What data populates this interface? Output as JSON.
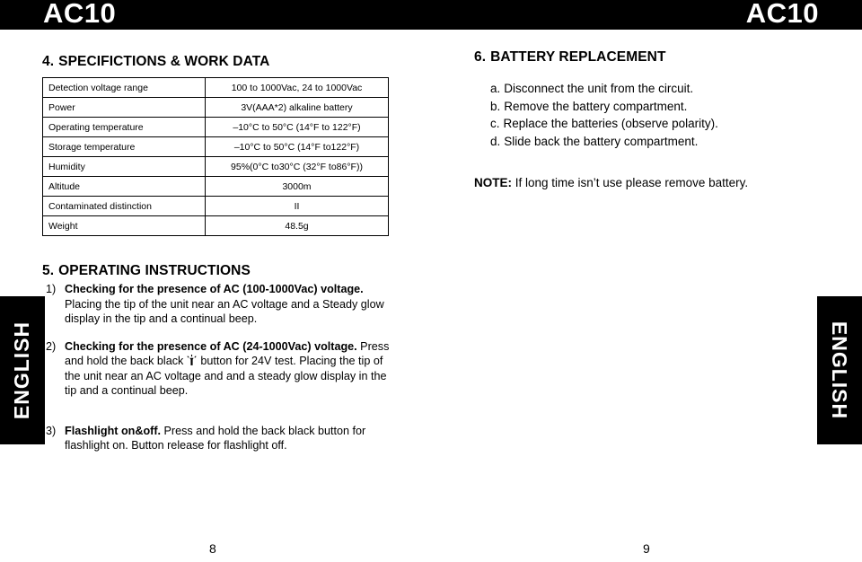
{
  "header": {
    "title_left": "AC10",
    "title_right": "AC10"
  },
  "side_tabs": {
    "left_label": "ENGLISH",
    "right_label": "ENGLISH"
  },
  "specifications": {
    "heading_number": "4.",
    "heading_text": "SPECIFICTIONS & WORK DATA",
    "rows": [
      {
        "label": "Detection voltage range",
        "value": "100 to 1000Vac, 24 to 1000Vac"
      },
      {
        "label": "Power",
        "value": "3V(AAA*2) alkaline battery"
      },
      {
        "label": "Operating temperature",
        "value": "–10°C to 50°C (14°F to 122°F)"
      },
      {
        "label": "Storage temperature",
        "value": "–10°C to 50°C (14°F to122°F)"
      },
      {
        "label": "Humidity",
        "value": "95%(0°C to30°C (32°F to86°F))"
      },
      {
        "label": "Altitude",
        "value": "3000m"
      },
      {
        "label": "Contaminated distinction",
        "value": "II"
      },
      {
        "label": "Weight",
        "value": "48.5g"
      }
    ]
  },
  "operating_instructions": {
    "heading_number": "5.",
    "heading_text": "OPERATING INSTRUCTIONS",
    "items": [
      {
        "marker": "1)",
        "bold": "Checking for the presence of AC (100-1000Vac) voltage.",
        "rest": " Placing the tip of the unit near an AC voltage and a Steady glow display in the tip and a continual beep."
      },
      {
        "marker": "2)",
        "bold": "Checking for the presence of AC (24-1000Vac) voltage.",
        "rest_before_icon": " Press and hold the back black",
        "icon": "flashlight-icon",
        "rest_after_icon": "button for 24V test. Placing the tip of the unit near an AC voltage and and a steady glow display in the tip and a continual beep."
      },
      {
        "marker": "3)",
        "bold": "Flashlight on&off.",
        "rest": " Press and hold the back black button for flashlight on. Button release for flashlight off."
      }
    ]
  },
  "battery_replacement": {
    "heading_number": "6.",
    "heading_text": "BATTERY REPLACEMENT",
    "steps": [
      {
        "letter": "a.",
        "text": "Disconnect the unit from the circuit."
      },
      {
        "letter": "b.",
        "text": "Remove the battery compartment."
      },
      {
        "letter": "c.",
        "text": "Replace the batteries (observe polarity)."
      },
      {
        "letter": "d.",
        "text": "Slide back the battery compartment."
      }
    ],
    "note_label": "NOTE:",
    "note_text": " If long time isn’t use please remove battery."
  },
  "page_numbers": {
    "left": "8",
    "right": "9"
  },
  "colors": {
    "bar": "#000000",
    "text": "#000000",
    "page": "#ffffff"
  }
}
